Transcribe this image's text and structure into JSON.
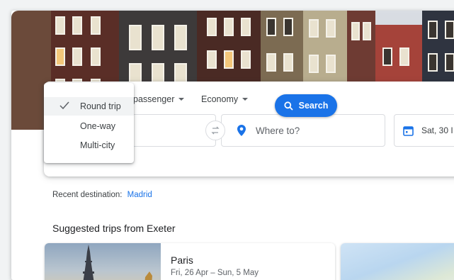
{
  "trip_options": {
    "passenger_label": "passenger",
    "cabin_label": "Economy"
  },
  "trip_type_menu": {
    "items": [
      {
        "label": "Round trip",
        "selected": true
      },
      {
        "label": "One-way",
        "selected": false
      },
      {
        "label": "Multi-city",
        "selected": false
      }
    ]
  },
  "search_form": {
    "destination_placeholder": "Where to?",
    "departure_date": "Sat, 30 I",
    "search_label": "Search"
  },
  "recent": {
    "label": "Recent destination:",
    "destination": "Madrid"
  },
  "suggestions": {
    "heading": "Suggested trips from Exeter",
    "trips": [
      {
        "city": "Paris",
        "dates": "Fri, 26 Apr – Sun, 5 May"
      }
    ]
  },
  "colors": {
    "accent": "#1a73e8",
    "text": "#3c4043",
    "muted": "#5f6368"
  },
  "icons": {
    "check": "check-icon",
    "swap": "swap-icon",
    "location": "location-pin-icon",
    "calendar": "calendar-icon",
    "search": "search-icon"
  }
}
